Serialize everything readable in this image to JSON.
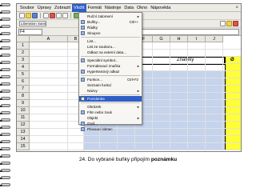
{
  "menubar": {
    "items": [
      "Soubor",
      "Úpravy",
      "Zobrazit",
      "Vložit",
      "Formát",
      "Nástroje",
      "Data",
      "Okno",
      "Nápověda"
    ],
    "active_index": 3,
    "close_glyph": "×"
  },
  "toolbar": {
    "font_name": "Liberation Sans"
  },
  "formula_bar": {
    "cell_ref": "F4"
  },
  "sheet": {
    "columns": [
      "A",
      "B",
      "C",
      "D",
      "E",
      "F",
      "G",
      "H",
      "I",
      "J"
    ],
    "rows": [
      "1",
      "2",
      "3",
      "4",
      "5",
      "6",
      "7",
      "8",
      "9",
      "10",
      "11",
      "12",
      "13",
      "14",
      "15"
    ],
    "header_cell_text": "Známky",
    "average_symbol": "Ø"
  },
  "insert_menu": {
    "items": [
      {
        "label": "Ruční zalomení",
        "shortcut": "",
        "submenu": true,
        "icon": "none"
      },
      {
        "label": "Buňky...",
        "shortcut": "Ctrl++",
        "submenu": false,
        "icon": "cells-icon"
      },
      {
        "label": "Řádky",
        "shortcut": "",
        "submenu": false,
        "icon": "rows-icon"
      },
      {
        "label": "Sloupce",
        "shortcut": "",
        "submenu": false,
        "icon": "columns-icon"
      },
      {
        "label": "List...",
        "shortcut": "",
        "submenu": false,
        "icon": "none"
      },
      {
        "label": "List ze souboru...",
        "shortcut": "",
        "submenu": false,
        "icon": "none"
      },
      {
        "label": "Odkaz na externí data...",
        "shortcut": "",
        "submenu": false,
        "icon": "none"
      },
      {
        "label": "Speciální symbol...",
        "shortcut": "",
        "submenu": false,
        "icon": "omega-icon"
      },
      {
        "label": "Formátovací značka",
        "shortcut": "",
        "submenu": true,
        "icon": "none"
      },
      {
        "label": "Hypertextový odkaz",
        "shortcut": "",
        "submenu": false,
        "icon": "link-icon"
      },
      {
        "label": "Funkce...",
        "shortcut": "Ctrl+F2",
        "submenu": false,
        "icon": "function-icon"
      },
      {
        "label": "Seznam funkcí",
        "shortcut": "",
        "submenu": false,
        "icon": "none"
      },
      {
        "label": "Názvy",
        "shortcut": "",
        "submenu": true,
        "icon": "none"
      },
      {
        "label": "Poznámka",
        "shortcut": "",
        "submenu": false,
        "icon": "note-icon"
      },
      {
        "label": "Obrázek",
        "shortcut": "",
        "submenu": true,
        "icon": "none"
      },
      {
        "label": "Film nebo zvuk",
        "shortcut": "",
        "submenu": false,
        "icon": "film-icon"
      },
      {
        "label": "Objekt",
        "shortcut": "",
        "submenu": true,
        "icon": "none"
      },
      {
        "label": "Graf...",
        "shortcut": "",
        "submenu": false,
        "icon": "chart-icon"
      },
      {
        "label": "Plovoucí rámec",
        "shortcut": "",
        "submenu": false,
        "icon": "frame-icon"
      }
    ],
    "highlighted_index": 13
  },
  "caption": {
    "prefix": "24. Do vybrané buňky připojím ",
    "bold": "poznámku"
  }
}
